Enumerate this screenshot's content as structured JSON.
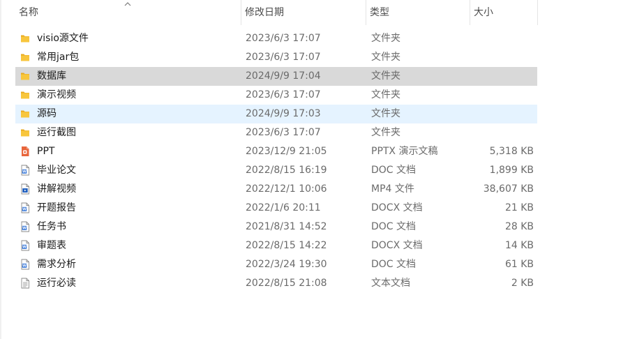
{
  "columns": {
    "name": "名称",
    "date": "修改日期",
    "type": "类型",
    "size": "大小"
  },
  "files": [
    {
      "name": "visio源文件",
      "date": "2023/6/3 17:07",
      "type": "文件夹",
      "size": "",
      "icon": "folder-icon"
    },
    {
      "name": "常用jar包",
      "date": "2023/6/3 17:07",
      "type": "文件夹",
      "size": "",
      "icon": "folder-icon"
    },
    {
      "name": "数据库",
      "date": "2024/9/9 17:04",
      "type": "文件夹",
      "size": "",
      "icon": "folder-icon",
      "state": "selected"
    },
    {
      "name": "演示视频",
      "date": "2023/6/3 17:07",
      "type": "文件夹",
      "size": "",
      "icon": "folder-icon"
    },
    {
      "name": "源码",
      "date": "2024/9/9 17:03",
      "type": "文件夹",
      "size": "",
      "icon": "folder-icon",
      "state": "hover"
    },
    {
      "name": "运行截图",
      "date": "2023/6/3 17:07",
      "type": "文件夹",
      "size": "",
      "icon": "folder-icon"
    },
    {
      "name": "PPT",
      "date": "2023/12/9 21:05",
      "type": "PPTX 演示文稿",
      "size": "5,318 KB",
      "icon": "powerpoint-icon"
    },
    {
      "name": "毕业论文",
      "date": "2022/8/15 16:19",
      "type": "DOC 文档",
      "size": "1,899 KB",
      "icon": "word-doc-icon"
    },
    {
      "name": "讲解视频",
      "date": "2022/12/1 10:06",
      "type": "MP4 文件",
      "size": "38,607 KB",
      "icon": "video-file-icon"
    },
    {
      "name": "开题报告",
      "date": "2022/1/6 20:11",
      "type": "DOCX 文档",
      "size": "21 KB",
      "icon": "word-doc-icon"
    },
    {
      "name": "任务书",
      "date": "2021/8/31 14:52",
      "type": "DOC 文档",
      "size": "28 KB",
      "icon": "word-doc-icon"
    },
    {
      "name": "审题表",
      "date": "2022/8/15 14:22",
      "type": "DOCX 文档",
      "size": "14 KB",
      "icon": "word-doc-icon"
    },
    {
      "name": "需求分析",
      "date": "2022/3/24 19:30",
      "type": "DOC 文档",
      "size": "61 KB",
      "icon": "word-doc-icon"
    },
    {
      "name": "运行必读",
      "date": "2022/8/15 21:08",
      "type": "文本文档",
      "size": "2 KB",
      "icon": "text-file-icon"
    }
  ],
  "colors": {
    "folder": "#f8c63d",
    "selected_row": "#d9d9d9",
    "hover_row": "#e5f3ff",
    "word_blue": "#2b6fd6",
    "ppt_orange": "#e8663c"
  }
}
